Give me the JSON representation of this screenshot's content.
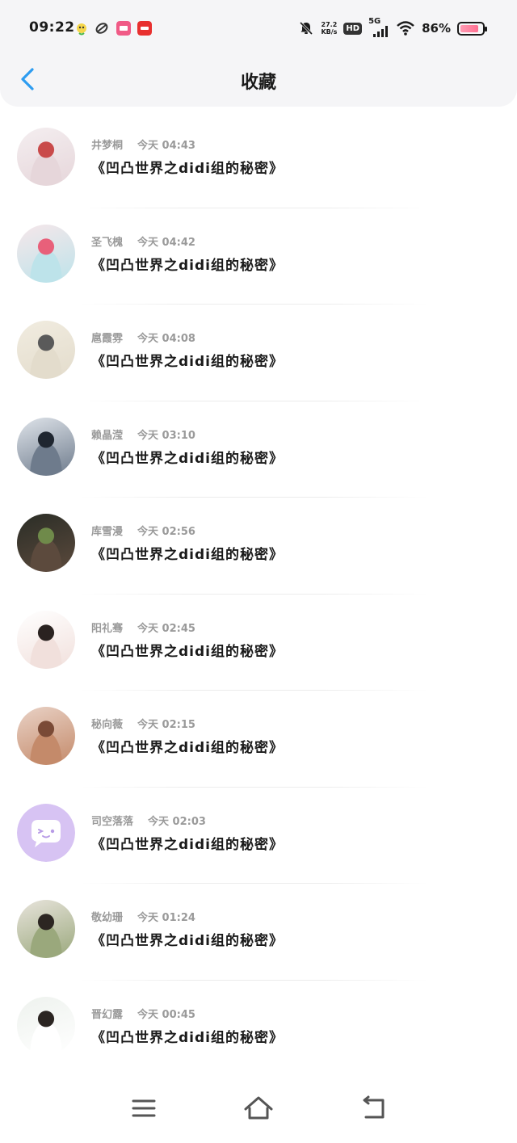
{
  "status_bar": {
    "time": "09:22",
    "speed_value": "27.2",
    "speed_unit": "KB/s",
    "hd_label": "HD",
    "network": "5G",
    "battery_percent": "86%",
    "battery_level": 0.86,
    "icons": [
      "app-icon-1",
      "app-icon-2",
      "app-icon-3",
      "app-icon-4",
      "mute-bell-icon",
      "signal-icon",
      "wifi-icon",
      "battery-icon"
    ]
  },
  "header": {
    "title": "收藏",
    "back_icon": "chevron-left-icon",
    "accent": "#2d9cf0"
  },
  "list": {
    "items": [
      {
        "name": "井梦桐",
        "time": "今天  04:43",
        "title": "《凹凸世界之didi组的秘密》",
        "avatar_colors": [
          "#f4eef0",
          "#e6d6da",
          "#c94a4a"
        ]
      },
      {
        "name": "圣飞槐",
        "time": "今天  04:42",
        "title": "《凹凸世界之didi组的秘密》",
        "avatar_colors": [
          "#f6e7ea",
          "#bde3ea",
          "#e8607a"
        ]
      },
      {
        "name": "扈霞雰",
        "time": "今天  04:08",
        "title": "《凹凸世界之didi组的秘密》",
        "avatar_colors": [
          "#f1ece0",
          "#e3dccc",
          "#5a5a5a"
        ]
      },
      {
        "name": "赖晶滢",
        "time": "今天  03:10",
        "title": "《凹凸世界之didi组的秘密》",
        "avatar_colors": [
          "#dfe4ea",
          "#6e7b8c",
          "#1f2630"
        ]
      },
      {
        "name": "库雪漫",
        "time": "今天  02:56",
        "title": "《凹凸世界之didi组的秘密》",
        "avatar_colors": [
          "#2a2d26",
          "#5c4a3d",
          "#6f8a4a"
        ]
      },
      {
        "name": "阳礼骞",
        "time": "今天  02:45",
        "title": "《凹凸世界之didi组的秘密》",
        "avatar_colors": [
          "#ffffff",
          "#f1e0dc",
          "#2a2220"
        ]
      },
      {
        "name": "秘向薇",
        "time": "今天  02:15",
        "title": "《凹凸世界之didi组的秘密》",
        "avatar_colors": [
          "#e9d2c6",
          "#c48a6a",
          "#7a4a36"
        ]
      },
      {
        "name": "司空落落",
        "time": "今天  02:03",
        "title": "《凹凸世界之didi组的秘密》",
        "avatar_colors": [
          "#d7c3f3",
          "#d7c3f3",
          "#ffffff"
        ]
      },
      {
        "name": "敬幼珊",
        "time": "今天  01:24",
        "title": "《凹凸世界之didi组的秘密》",
        "avatar_colors": [
          "#e8e4dc",
          "#9aa87c",
          "#2c2622"
        ]
      },
      {
        "name": "晋幻露",
        "time": "今天  00:45",
        "title": "《凹凸世界之didi组的秘密》",
        "avatar_colors": [
          "#eef2ee",
          "#ffffff",
          "#2b2522"
        ]
      }
    ]
  },
  "nav_bar": {
    "menu_icon": "menu-icon",
    "home_icon": "home-icon",
    "back_icon": "back-return-icon"
  }
}
